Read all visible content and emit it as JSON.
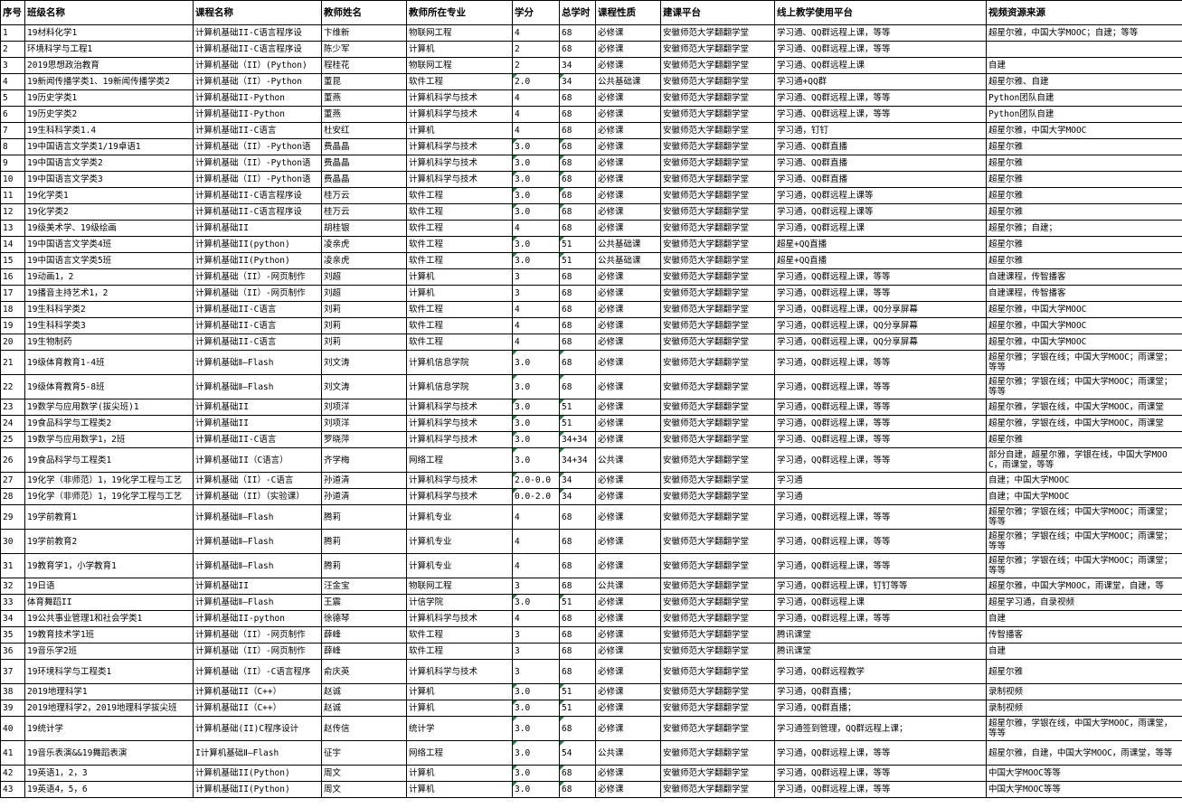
{
  "headers": [
    "序号",
    "班级名称",
    "课程名称",
    "教师姓名",
    "教师所在专业",
    "学分",
    "总学时",
    "课程性质",
    "建课平台",
    "线上教学使用平台",
    "视频资源来源"
  ],
  "rows": [
    {
      "h": 1,
      "c": [
        "1",
        "19材料化学1",
        "计算机基础II-C语言程序设",
        "卞维新",
        "物联网工程",
        "4",
        "68",
        "必修课",
        "安徽师范大学翻翻学堂",
        "学习通、QQ群远程上课，等等",
        "超星尔雅，中国大学MOOC；自建；等等"
      ]
    },
    {
      "h": 1,
      "c": [
        "2",
        "环境科学与工程1",
        "计算机基础II-C语言程序设",
        "陈少军",
        "计算机",
        "2",
        "68",
        "必修课",
        "安徽师范大学翻翻学堂",
        "学习通、QQ群远程上课，等等",
        ""
      ]
    },
    {
      "h": 1,
      "c": [
        "3",
        "2019思想政治教育",
        "计算机基础（II）(Python)",
        "程桂花",
        "物联网工程",
        "2",
        "34",
        "必修课",
        "安徽师范大学翻翻学堂",
        "学习通、QQ群远程上课",
        "自建"
      ]
    },
    {
      "h": 1,
      "c": [
        "4",
        "19新闻传播学类1、19新闻传播学类2",
        "计算机基础（II）-Python",
        "董昆",
        "软件工程",
        "2.0",
        "34",
        "公共基础课",
        "安徽师范大学翻翻学堂",
        "学习通+QQ群",
        "超星尔雅、自建"
      ]
    },
    {
      "h": 1,
      "c": [
        "5",
        "19历史学类1",
        "计算机基础II-Python",
        "董燕",
        "计算机科学与技术",
        "4",
        "68",
        "必修课",
        "安徽师范大学翻翻学堂",
        "学习通、QQ群远程上课，等等",
        "Python团队自建"
      ]
    },
    {
      "h": 1,
      "c": [
        "6",
        "19历史学类2",
        "计算机基础II-Python",
        "董燕",
        "计算机科学与技术",
        "4",
        "68",
        "必修课",
        "安徽师范大学翻翻学堂",
        "学习通、QQ群远程上课，等等",
        "Python团队自建"
      ]
    },
    {
      "h": 1,
      "c": [
        "7",
        "19生科科学类1.4",
        "计算机基础II-C语言",
        "杜安红",
        "计算机",
        "4",
        "68",
        "必修课",
        "安徽师范大学翻翻学堂",
        "学习通，钉钉",
        "超星尔雅，中国大学MOOC"
      ]
    },
    {
      "h": 1,
      "c": [
        "8",
        "19中国语言文学类1/19卓语1",
        "计算机基础（II）-Python语",
        "费晶晶",
        "计算机科学与技术",
        "3.0",
        "68",
        "必修课",
        "安徽师范大学翻翻学堂",
        "学习通、QQ群直播",
        "超星尔雅"
      ]
    },
    {
      "h": 1,
      "c": [
        "9",
        "19中国语言文学类2",
        "计算机基础（II）-Python语",
        "费晶晶",
        "计算机科学与技术",
        "3.0",
        "68",
        "必修课",
        "安徽师范大学翻翻学堂",
        "学习通、QQ群直播",
        "超星尔雅"
      ]
    },
    {
      "h": 1,
      "c": [
        "10",
        "19中国语言文学类3",
        "计算机基础（II）-Python语",
        "费晶晶",
        "计算机科学与技术",
        "3.0",
        "68",
        "必修课",
        "安徽师范大学翻翻学堂",
        "学习通、QQ群直播",
        "超星尔雅"
      ]
    },
    {
      "h": 1,
      "c": [
        "11",
        "19化学类1",
        "计算机基础II-C语言程序设",
        "桂万云",
        "软件工程",
        "3.0",
        "68",
        "必修课",
        "安徽师范大学翻翻学堂",
        "学习通，QQ群远程上课等",
        "超星尔雅"
      ]
    },
    {
      "h": 1,
      "c": [
        "12",
        "19化学类2",
        "计算机基础II-C语言程序设",
        "桂万云",
        "软件工程",
        "3.0",
        "68",
        "必修课",
        "安徽师范大学翻翻学堂",
        "学习通，QQ群远程上课等",
        "超星尔雅"
      ]
    },
    {
      "h": 1,
      "c": [
        "13",
        "19级美术学、19级绘画",
        "计算机基础II",
        "胡桂银",
        "软件工程",
        "4",
        "68",
        "必修课",
        "安徽师范大学翻翻学堂",
        "学习通，QQ群远程上课",
        "超星尔雅；自建；"
      ]
    },
    {
      "h": 1,
      "c": [
        "14",
        "19中国语言文学类4班",
        "计算机基础II(python)",
        "凌亲虎",
        "软件工程",
        "3.0",
        "51",
        "公共基础课",
        "安徽师范大学翻翻学堂",
        "超星+QQ直播",
        "超星尔雅"
      ]
    },
    {
      "h": 1,
      "c": [
        "15",
        "19中国语言文学类5班",
        "计算机基础II(Python)",
        "凌亲虎",
        "软件工程",
        "3.0",
        "51",
        "公共基础课",
        "安徽师范大学翻翻学堂",
        "超星+QQ直播",
        "超星尔雅"
      ]
    },
    {
      "h": 1,
      "c": [
        "16",
        "19动画1，2",
        "计算机基础（II）-网页制作",
        "刘超",
        "计算机",
        "3",
        "68",
        "必修课",
        "安徽师范大学翻翻学堂",
        "学习通，QQ群远程上课，等等",
        "自建课程，传智播客"
      ]
    },
    {
      "h": 1,
      "c": [
        "17",
        "19播音主持艺术1，2",
        "计算机基础（II）-网页制作",
        "刘超",
        "计算机",
        "3",
        "68",
        "必修课",
        "安徽师范大学翻翻学堂",
        "学习通，QQ群远程上课，等等",
        "自建课程，传智播客"
      ]
    },
    {
      "h": 1,
      "c": [
        "18",
        "19生科科学类2",
        "计算机基础II-C语言",
        "刘莉",
        "软件工程",
        "4",
        "68",
        "必修课",
        "安徽师范大学翻翻学堂",
        "学习通，QQ群远程上课，QQ分享屏幕",
        "超星尔雅，中国大学MOOC"
      ]
    },
    {
      "h": 1,
      "c": [
        "19",
        "19生科科学类3",
        "计算机基础II-C语言",
        "刘莉",
        "软件工程",
        "4",
        "68",
        "必修课",
        "安徽师范大学翻翻学堂",
        "学习通，QQ群远程上课，QQ分享屏幕",
        "超星尔雅，中国大学MOOC"
      ]
    },
    {
      "h": 1,
      "c": [
        "20",
        "19生物制药",
        "计算机基础II-C语言",
        "刘莉",
        "软件工程",
        "4",
        "68",
        "必修课",
        "安徽师范大学翻翻学堂",
        "学习通，QQ群远程上课，QQ分享屏幕",
        "超星尔雅，中国大学MOOC"
      ]
    },
    {
      "h": 2,
      "c": [
        "21",
        "19级体育教育1-4班",
        "计算机基础Ⅱ—Flash",
        "刘文涛",
        "计算机信息学院",
        "3.0",
        "68",
        "必修课",
        "安徽师范大学翻翻学堂",
        "学习通，QQ群远程上课，等等",
        "超星尔雅；学银在线；中国大学MOOC；雨课堂；等等"
      ]
    },
    {
      "h": 2,
      "c": [
        "22",
        "19级体育教育5-8班",
        "计算机基础Ⅱ—Flash",
        "刘文涛",
        "计算机信息学院",
        "3.0",
        "68",
        "必修课",
        "安徽师范大学翻翻学堂",
        "学习通，QQ群远程上课，等等",
        "超星尔雅；学银在线；中国大学MOOC；雨课堂；等等"
      ]
    },
    {
      "h": 1,
      "c": [
        "23",
        "19数学与应用数学(拔尖班)1",
        "计算机基础II",
        "刘项洋",
        "计算机科学与技术",
        "3.0",
        "51",
        "必修课",
        "安徽师范大学翻翻学堂",
        "学习通，QQ群远程上课，等等",
        "超星尔雅，学银在线，中国大学MOOC，雨课堂"
      ]
    },
    {
      "h": 1,
      "c": [
        "24",
        "19食品科学与工程类2",
        "计算机基础II",
        "刘项洋",
        "计算机科学与技术",
        "3.0",
        "51",
        "必修课",
        "安徽师范大学翻翻学堂",
        "学习通，QQ群远程上课，等等",
        "超星尔雅，学银在线，中国大学MOOC，雨课堂"
      ]
    },
    {
      "h": 1,
      "c": [
        "25",
        "19数学与应用数学1，2班",
        "计算机基础II-C语言",
        "罗晓萍",
        "计算机科学与技术",
        "3.0",
        "34+34",
        "必修课",
        "安徽师范大学翻翻学堂",
        "学习通、QQ群远程上课，等等",
        "超星尔雅"
      ]
    },
    {
      "h": 2,
      "c": [
        "26",
        "19食品科学与工程类1",
        "计算机基础II（C语言）",
        "齐学梅",
        "网络工程",
        "3.0",
        "34+34",
        "公共课",
        "安徽师范大学翻翻学堂",
        "学习通，QQ群远程上课，等等",
        "部分自建，超星尔雅，学银在线，中国大学MOOC，雨课堂，等等"
      ]
    },
    {
      "h": 1,
      "c": [
        "27",
        "19化学（非师范）1，19化学工程与工艺",
        "计算机基础（II）-C语言",
        "孙道清",
        "计算机科学与技术",
        "2.0-0.0",
        "34",
        "必修课",
        "安徽师范大学翻翻学堂",
        "学习通",
        "自建；中国大学MOOC"
      ]
    },
    {
      "h": 1,
      "c": [
        "28",
        "19化学（非师范）1，19化学工程与工艺",
        "计算机基础（II）（实验课）",
        "孙道清",
        "计算机科学与技术",
        "0.0-2.0",
        "34",
        "必修课",
        "安徽师范大学翻翻学堂",
        "学习通",
        "自建；中国大学MOOC"
      ]
    },
    {
      "h": 2,
      "c": [
        "29",
        "19学前教育1",
        "计算机基础Ⅱ—Flash",
        "腾莉",
        "计算机专业",
        "4",
        "68",
        "必修课",
        "安徽师范大学翻翻学堂",
        "学习通，QQ群远程上课，等等",
        "超星尔雅；学银在线；中国大学MOOC；雨课堂；等等"
      ]
    },
    {
      "h": 2,
      "c": [
        "30",
        "19学前教育2",
        "计算机基础Ⅱ—Flash",
        "腾莉",
        "计算机专业",
        "4",
        "68",
        "必修课",
        "安徽师范大学翻翻学堂",
        "学习通，QQ群远程上课，等等",
        "超星尔雅；学银在线；中国大学MOOC；雨课堂；等等"
      ]
    },
    {
      "h": 2,
      "c": [
        "31",
        "19教育学1，小学教育1",
        "计算机基础Ⅱ—Flash",
        "腾莉",
        "计算机专业",
        "4",
        "68",
        "必修课",
        "安徽师范大学翻翻学堂",
        "学习通，QQ群远程上课，等等",
        "超星尔雅；学银在线；中国大学MOOC；雨课堂；等等"
      ]
    },
    {
      "h": 1,
      "c": [
        "32",
        "19日语",
        "计算机基础II",
        "汪金宝",
        "物联网工程",
        "3",
        "68",
        "公共课",
        "安徽师范大学翻翻学堂",
        "学习通，QQ群远程上课，钉钉等等",
        "超星尔雅，中国大学MOOC，雨课堂，自建，等"
      ]
    },
    {
      "h": 1,
      "c": [
        "33",
        "体育舞蹈II",
        "计算机基础Ⅱ—Flash",
        "王震",
        "计信学院",
        "3.0",
        "51",
        "必修课",
        "安徽师范大学翻翻学堂",
        "学习通，QQ群远程上课",
        "超星学习通，自录视频"
      ]
    },
    {
      "h": 1,
      "c": [
        "34",
        "19公共事业管理1和社会学类1",
        "计算机基础II-python",
        "徐德琴",
        "计算机科学与技术",
        "4",
        "68",
        "必修课",
        "安徽师范大学翻翻学堂",
        "学习通，QQ群远程上课，等等",
        "自建"
      ]
    },
    {
      "h": 1,
      "c": [
        "35",
        "19教育技术学1班",
        "计算机基础（II）-网页制作",
        "薛峰",
        "软件工程",
        "3",
        "68",
        "必修课",
        "安徽师范大学翻翻学堂",
        "腾讯课堂",
        "传智播客"
      ]
    },
    {
      "h": 1,
      "c": [
        "36",
        "19音乐学2班",
        "计算机基础（II）-网页制作",
        "薛峰",
        "软件工程",
        "3",
        "68",
        "必修课",
        "安徽师范大学翻翻学堂",
        "腾讯课堂",
        "自建"
      ]
    },
    {
      "h": 2,
      "c": [
        "37",
        "19环境科学与工程类1",
        "计算机基础（II）-C语言程序",
        "俞庆英",
        "计算机科学与技术",
        "3",
        "68",
        "必修课",
        "安徽师范大学翻翻学堂",
        "学习通，QQ群远程教学",
        "超星尔雅"
      ]
    },
    {
      "h": 1,
      "c": [
        "38",
        "2019地理科学1",
        "计算机基础II（C++）",
        "赵诚",
        "计算机",
        "3.0",
        "51",
        "必修课",
        "安徽师范大学翻翻学堂",
        "学习通，QQ群直播；",
        "录制视频"
      ]
    },
    {
      "h": 1,
      "c": [
        "39",
        "2019地理科学2，2019地理科学拔尖班",
        "计算机基础II（C++）",
        "赵诚",
        "计算机",
        "3.0",
        "51",
        "必修课",
        "安徽师范大学翻翻学堂",
        "学习通，QQ群直播；",
        "录制视频"
      ]
    },
    {
      "h": 2,
      "c": [
        "40",
        "19统计学",
        "计算机基础(II)C程序设计",
        "赵传信",
        "统计学",
        "3.0",
        "68",
        "必修课",
        "安徽师范大学翻翻学堂",
        "学习通签到管理，QQ群远程上课；",
        "超星尔雅，学银在线，中国大学MOOC，雨课堂，等等"
      ]
    },
    {
      "h": 2,
      "c": [
        "41",
        "19音乐表演&&19舞蹈表演",
        "I计算机基础Ⅱ—Flash",
        "征宇",
        "网络工程",
        "3.0",
        "54",
        "公共课",
        "安徽师范大学翻翻学堂",
        "学习通，QQ群远程上课，等等",
        "超星尔雅，自建，中国大学MOOC，雨课堂，等等"
      ]
    },
    {
      "h": 1,
      "c": [
        "42",
        "19英语1，2，3",
        "计算机基础II(Python)",
        "周文",
        "计算机",
        "3.0",
        "68",
        "必修课",
        "安徽师范大学翻翻学堂",
        "学习通，QQ群远程上课，等等",
        "中国大学MOOC等等"
      ]
    },
    {
      "h": 1,
      "c": [
        "43",
        "19英语4，5，6",
        "计算机基础II(Python)",
        "周文",
        "计算机",
        "3.0",
        "68",
        "必修课",
        "安徽师范大学翻翻学堂",
        "学习通，QQ群远程上课，等等",
        "中国大学MOOC等等"
      ]
    }
  ]
}
